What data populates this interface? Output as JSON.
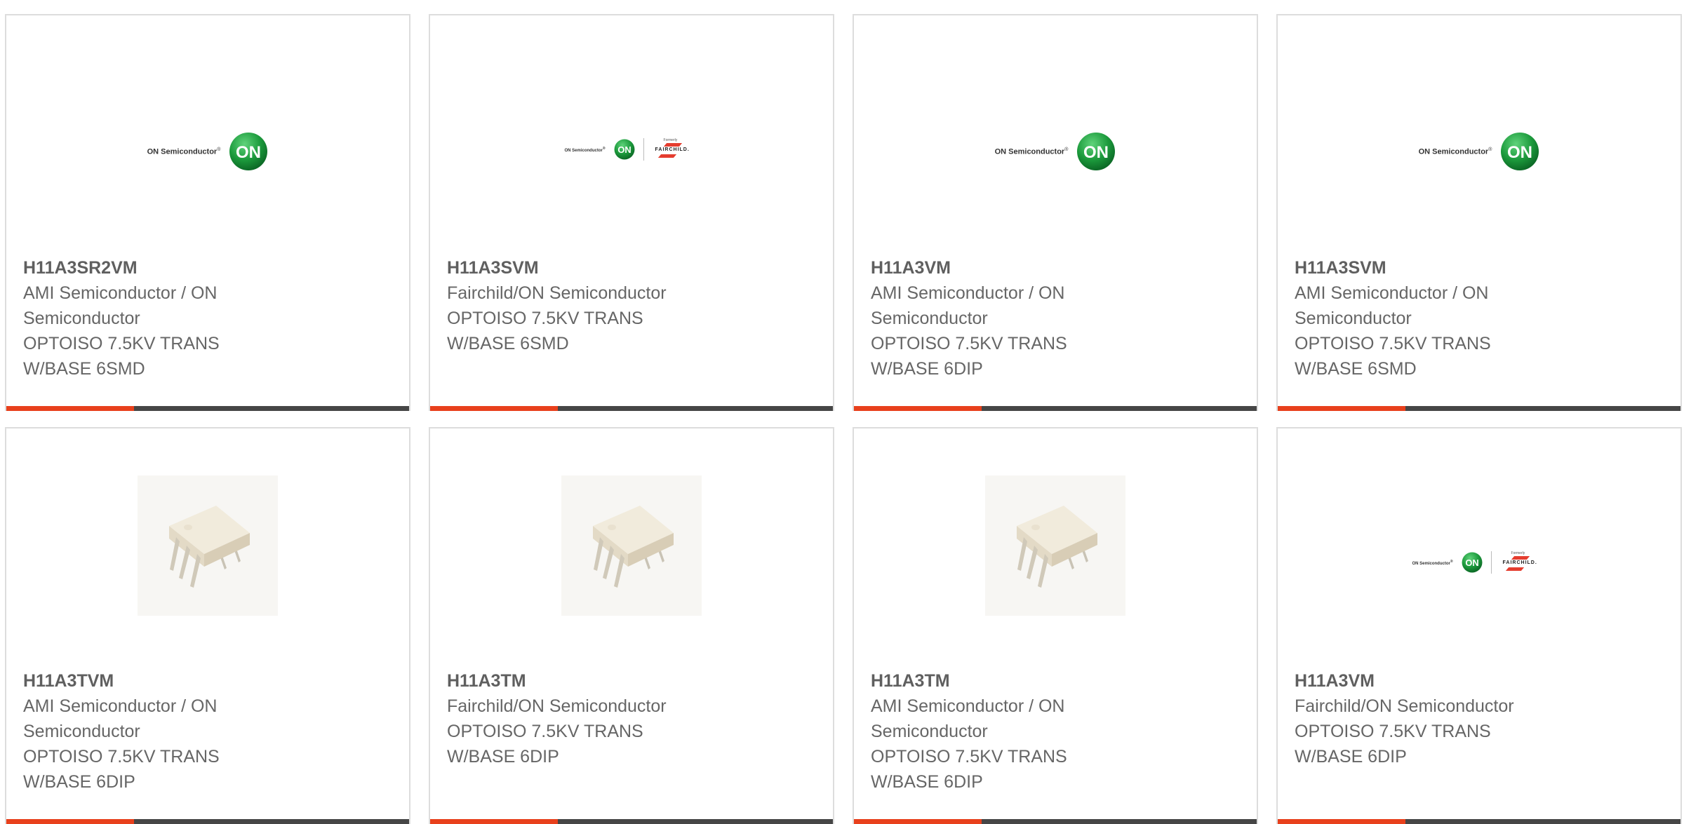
{
  "brand": {
    "accent_color": "#e8401c",
    "bar_color": "#464646",
    "on_logo_green": "#1c9a3c"
  },
  "logos": {
    "on_semi": {
      "wordmark": "ON Semiconductor",
      "registered": "®",
      "badge": "ON"
    },
    "fairchild": {
      "formerly": "Formerly",
      "name": "FAIRCHILD."
    }
  },
  "products": [
    {
      "part_number": "H11A3SR2VM",
      "manufacturer": "AMI Semiconductor / ON Semiconductor",
      "description": "OPTOISO 7.5KV TRANS W/BASE 6SMD",
      "image": "on-semiconductor-logo"
    },
    {
      "part_number": "H11A3SVM",
      "manufacturer": "Fairchild/ON Semiconductor",
      "description": "OPTOISO 7.5KV TRANS W/BASE 6SMD",
      "image": "on-fairchild-logo"
    },
    {
      "part_number": "H11A3VM",
      "manufacturer": "AMI Semiconductor / ON Semiconductor",
      "description": "OPTOISO 7.5KV TRANS W/BASE 6DIP",
      "image": "on-semiconductor-logo"
    },
    {
      "part_number": "H11A3SVM",
      "manufacturer": "AMI Semiconductor / ON Semiconductor",
      "description": "OPTOISO 7.5KV TRANS W/BASE 6SMD",
      "image": "on-semiconductor-logo"
    },
    {
      "part_number": "H11A3TVM",
      "manufacturer": "AMI Semiconductor / ON Semiconductor",
      "description": "OPTOISO 7.5KV TRANS W/BASE 6DIP",
      "image": "dip-6-package"
    },
    {
      "part_number": "H11A3TM",
      "manufacturer": "Fairchild/ON Semiconductor",
      "description": "OPTOISO 7.5KV TRANS W/BASE 6DIP",
      "image": "dip-6-package"
    },
    {
      "part_number": "H11A3TM",
      "manufacturer": "AMI Semiconductor / ON Semiconductor",
      "description": "OPTOISO 7.5KV TRANS W/BASE 6DIP",
      "image": "dip-6-package"
    },
    {
      "part_number": "H11A3VM",
      "manufacturer": "Fairchild/ON Semiconductor",
      "description": "OPTOISO 7.5KV TRANS W/BASE 6DIP",
      "image": "on-fairchild-logo"
    }
  ]
}
